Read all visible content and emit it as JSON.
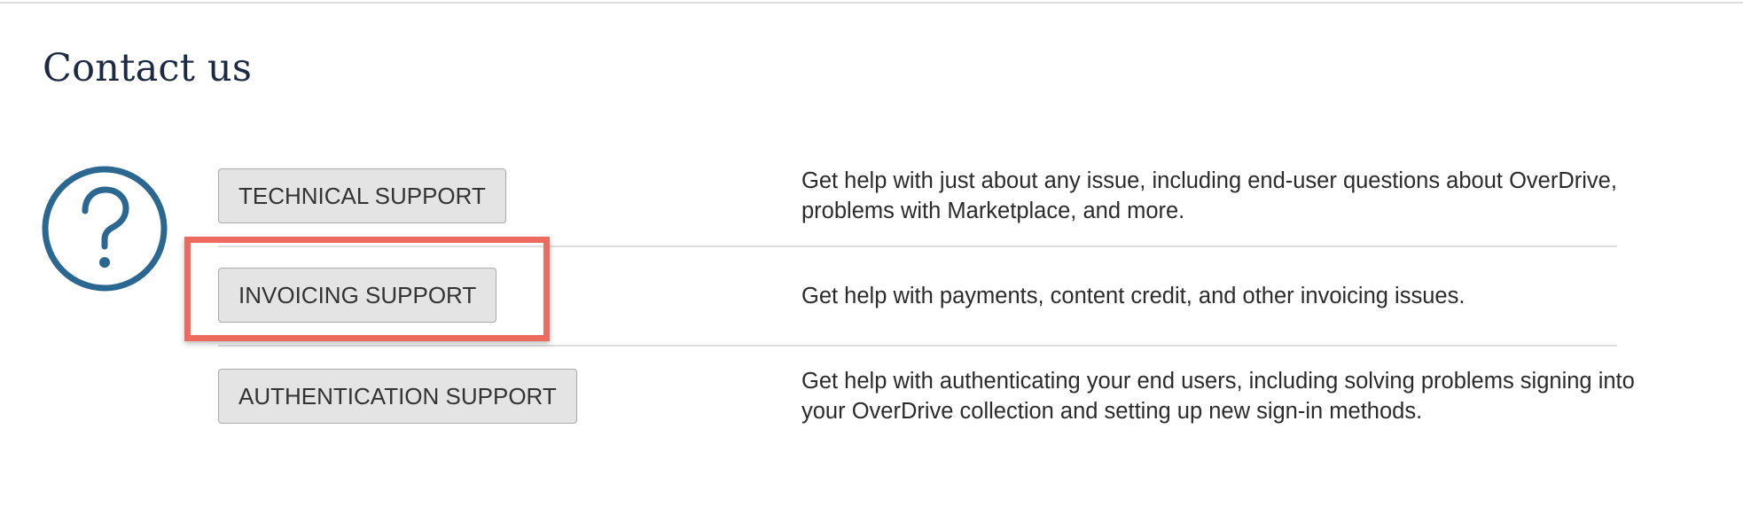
{
  "header": {
    "title": "Contact us"
  },
  "icon": {
    "name": "question-circle-icon",
    "color": "#2a6791"
  },
  "support_items": [
    {
      "button_label": "TECHNICAL SUPPORT",
      "description": "Get help with just about any issue, including end-user questions about OverDrive, problems with Marketplace, and more."
    },
    {
      "button_label": "INVOICING SUPPORT",
      "description": "Get help with payments, content credit, and other invoicing issues."
    },
    {
      "button_label": "AUTHENTICATION SUPPORT",
      "description": "Get help with authenticating your end users, including solving problems signing into your OverDrive collection and setting up new sign-in methods."
    }
  ],
  "highlight": {
    "target": "INVOICING SUPPORT",
    "color": "#ec6a5e"
  }
}
